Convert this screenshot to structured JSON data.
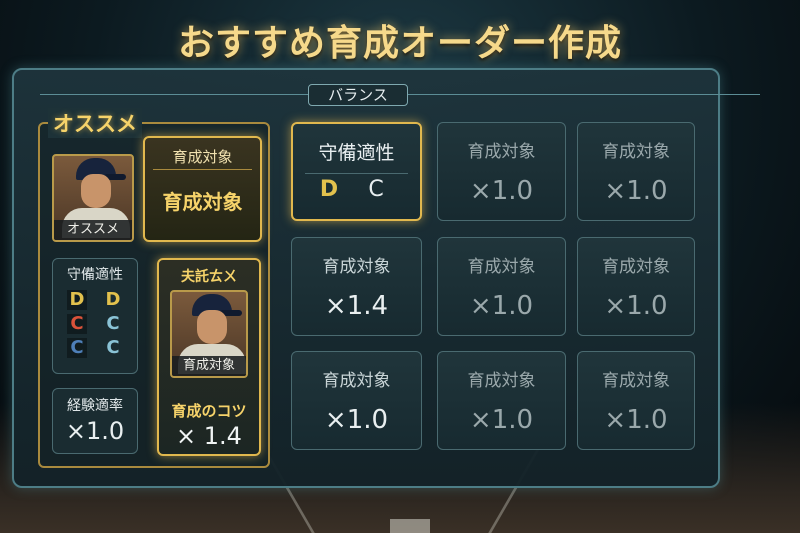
{
  "title": "おすすめ育成オーダー作成",
  "balance_label": "バランス",
  "recommend": {
    "section_label": "オススメ",
    "player_card": {
      "name": "オススメ"
    },
    "target_button": {
      "header": "育成対象",
      "label": "育成対象"
    },
    "defense": {
      "label": "守備適性",
      "grades": [
        [
          "D",
          "D"
        ],
        [
          "C",
          "C"
        ],
        [
          "C",
          "C"
        ]
      ],
      "grade_colors": [
        [
          "#e2c14d",
          "#e2c14d"
        ],
        [
          "#d9523a",
          "#8ac3d6"
        ],
        [
          "#4e7fb8",
          "#8ac3d6"
        ]
      ]
    },
    "experience": {
      "label": "経験適率",
      "value": "×1.0"
    },
    "tip_card": {
      "top_label": "夫託ㄊㄨ",
      "portrait_name": "育成対象",
      "tip_label": "育成のコツ",
      "tip_value": "× 1.4"
    }
  },
  "grid": {
    "row1": [
      {
        "head": "守備適性",
        "grades": [
          "D",
          "C"
        ],
        "grade_colors": [
          "#e2c14d",
          "#e8eef0"
        ]
      },
      {
        "head": "育成対象",
        "value": "×1.0"
      },
      {
        "head": "育成対象",
        "value": "×1.0"
      }
    ],
    "row2": [
      {
        "head": "育成対象",
        "value": "×1.4"
      },
      {
        "head": "育成対象",
        "value": "×1.0"
      },
      {
        "head": "育成対象",
        "value": "×1.0"
      }
    ],
    "row3": [
      {
        "head": "育成対象",
        "value": "×1.0"
      },
      {
        "head": "育成対象",
        "value": "×1.0"
      },
      {
        "head": "育成対象",
        "value": "×1.0"
      }
    ]
  },
  "colors": {
    "gold": "#e1b84e",
    "title": "#f6d98b",
    "panel_border": "#4d7d86"
  }
}
